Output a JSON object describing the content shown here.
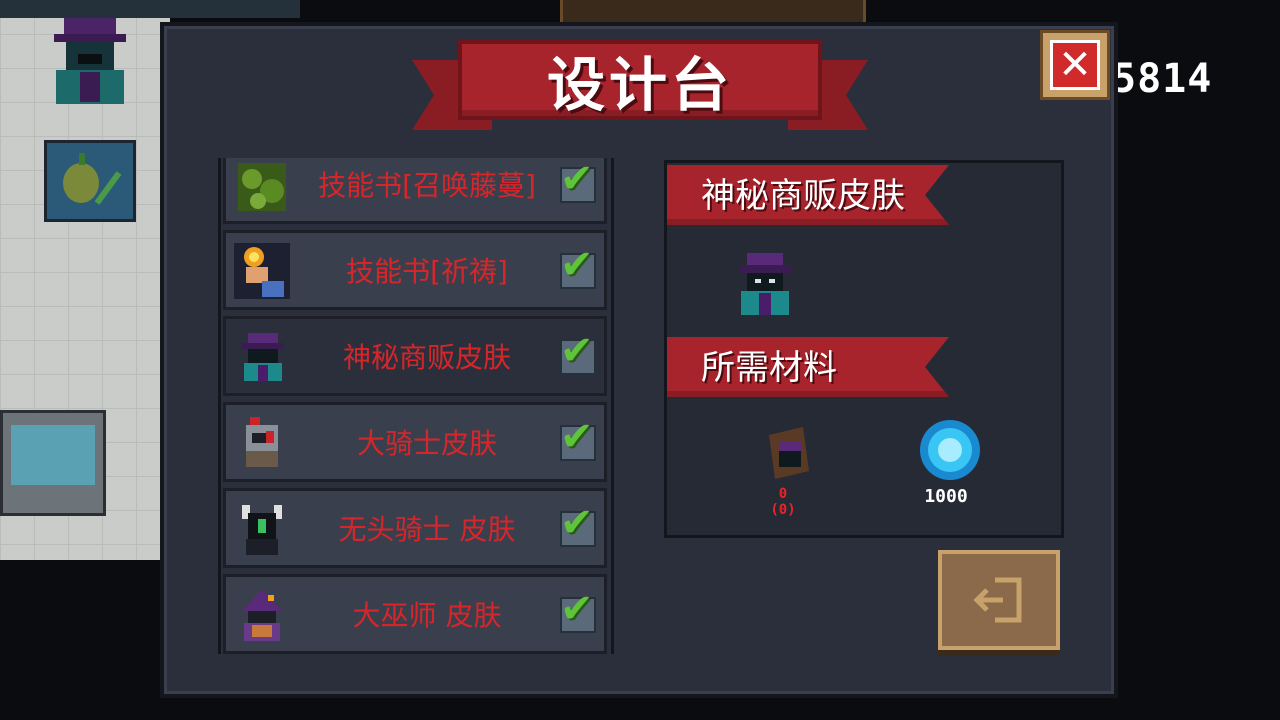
{
  "title": "设计台",
  "score": "5814",
  "close_icon": "close-icon",
  "exit_icon": "exit-door-icon",
  "items": [
    {
      "label": "技能书[召唤藤蔓]",
      "icon": "vine-book-icon",
      "checked": true
    },
    {
      "label": "技能书[祈祷]",
      "icon": "prayer-book-icon",
      "checked": true
    },
    {
      "label": "神秘商贩皮肤",
      "icon": "mysterious-merchant-icon",
      "checked": true,
      "selected": true
    },
    {
      "label": "大骑士皮肤",
      "icon": "grand-knight-icon",
      "checked": true
    },
    {
      "label": "无头骑士 皮肤",
      "icon": "headless-knight-icon",
      "checked": true
    },
    {
      "label": "大巫师 皮肤",
      "icon": "archmage-icon",
      "checked": true
    }
  ],
  "detail": {
    "name": "神秘商贩皮肤",
    "materials_heading": "所需材料",
    "material_count": "0",
    "material_owned": "(0)",
    "gem_count": "1000"
  },
  "colors": {
    "accent_red": "#a8242d",
    "label_red": "#d7262a",
    "check_green": "#5ec43a",
    "panel": "#2b2f3b"
  }
}
